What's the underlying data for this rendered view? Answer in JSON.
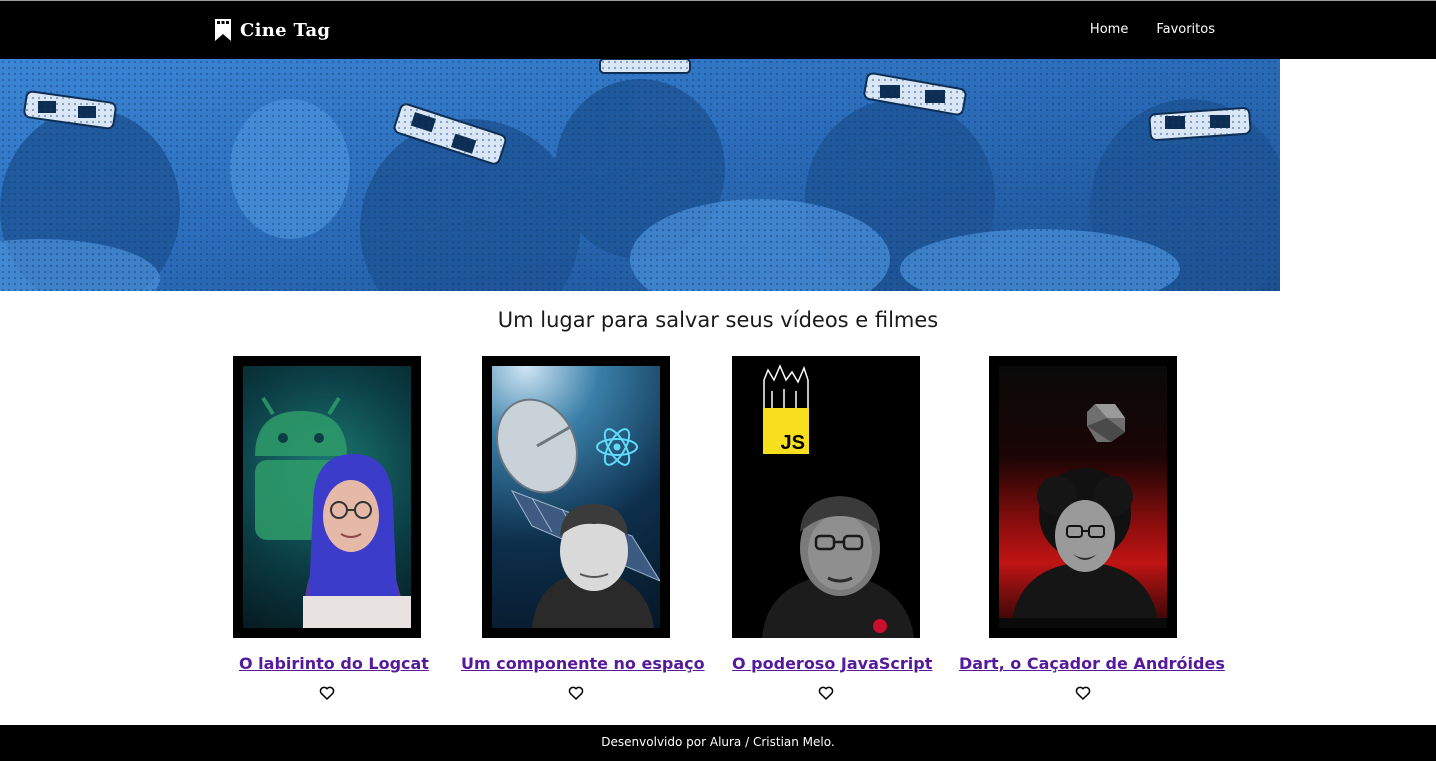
{
  "header": {
    "brand": "Cine Tag",
    "nav": [
      "Home",
      "Favoritos"
    ]
  },
  "hero": {
    "tagline": "Um lugar para salvar seus vídeos e filmes"
  },
  "videos": [
    {
      "title": "O labirinto do Logcat",
      "icon": "heart-outline-icon"
    },
    {
      "title": "Um componente no espaço",
      "icon": "heart-outline-icon"
    },
    {
      "title": "O poderoso JavaScript",
      "icon": "heart-outline-icon"
    },
    {
      "title": "Dart, o Caçador de Andróides",
      "icon": "heart-outline-icon"
    }
  ],
  "poster_badges": {
    "javascript": "JS"
  },
  "footer": {
    "text": "Desenvolvido por Alura / Cristian Melo."
  },
  "colors": {
    "header_bg": "#000000",
    "banner_tint": "#2a6fbf",
    "link": "#55199c",
    "footer_bg": "#000000"
  }
}
